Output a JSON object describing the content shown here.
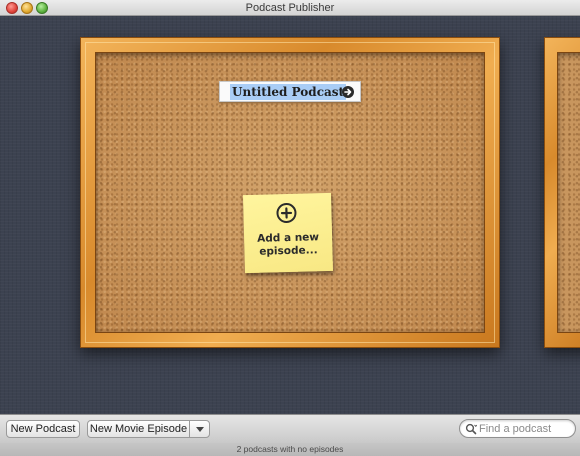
{
  "window": {
    "title": "Podcast Publisher"
  },
  "board": {
    "podcast_title": "Untitled Podcast",
    "go_icon": "arrow-right-circle-icon",
    "sticky_note": {
      "icon": "plus-circle-icon",
      "line1": "Add a new",
      "line2": "episode..."
    }
  },
  "toolbar": {
    "new_podcast_label": "New Podcast",
    "new_movie_episode_label": "New Movie Episode",
    "episode_menu_icon": "chevron-down-icon",
    "search_placeholder": "Find a podcast",
    "search_value": ""
  },
  "status": {
    "text": "2 podcasts with no episodes"
  },
  "colors": {
    "background": "#3c4250",
    "frame": "#e09a3c",
    "cork": "#c8965e",
    "sticky": "#fcef8e",
    "selection": "#a9cdf6"
  }
}
